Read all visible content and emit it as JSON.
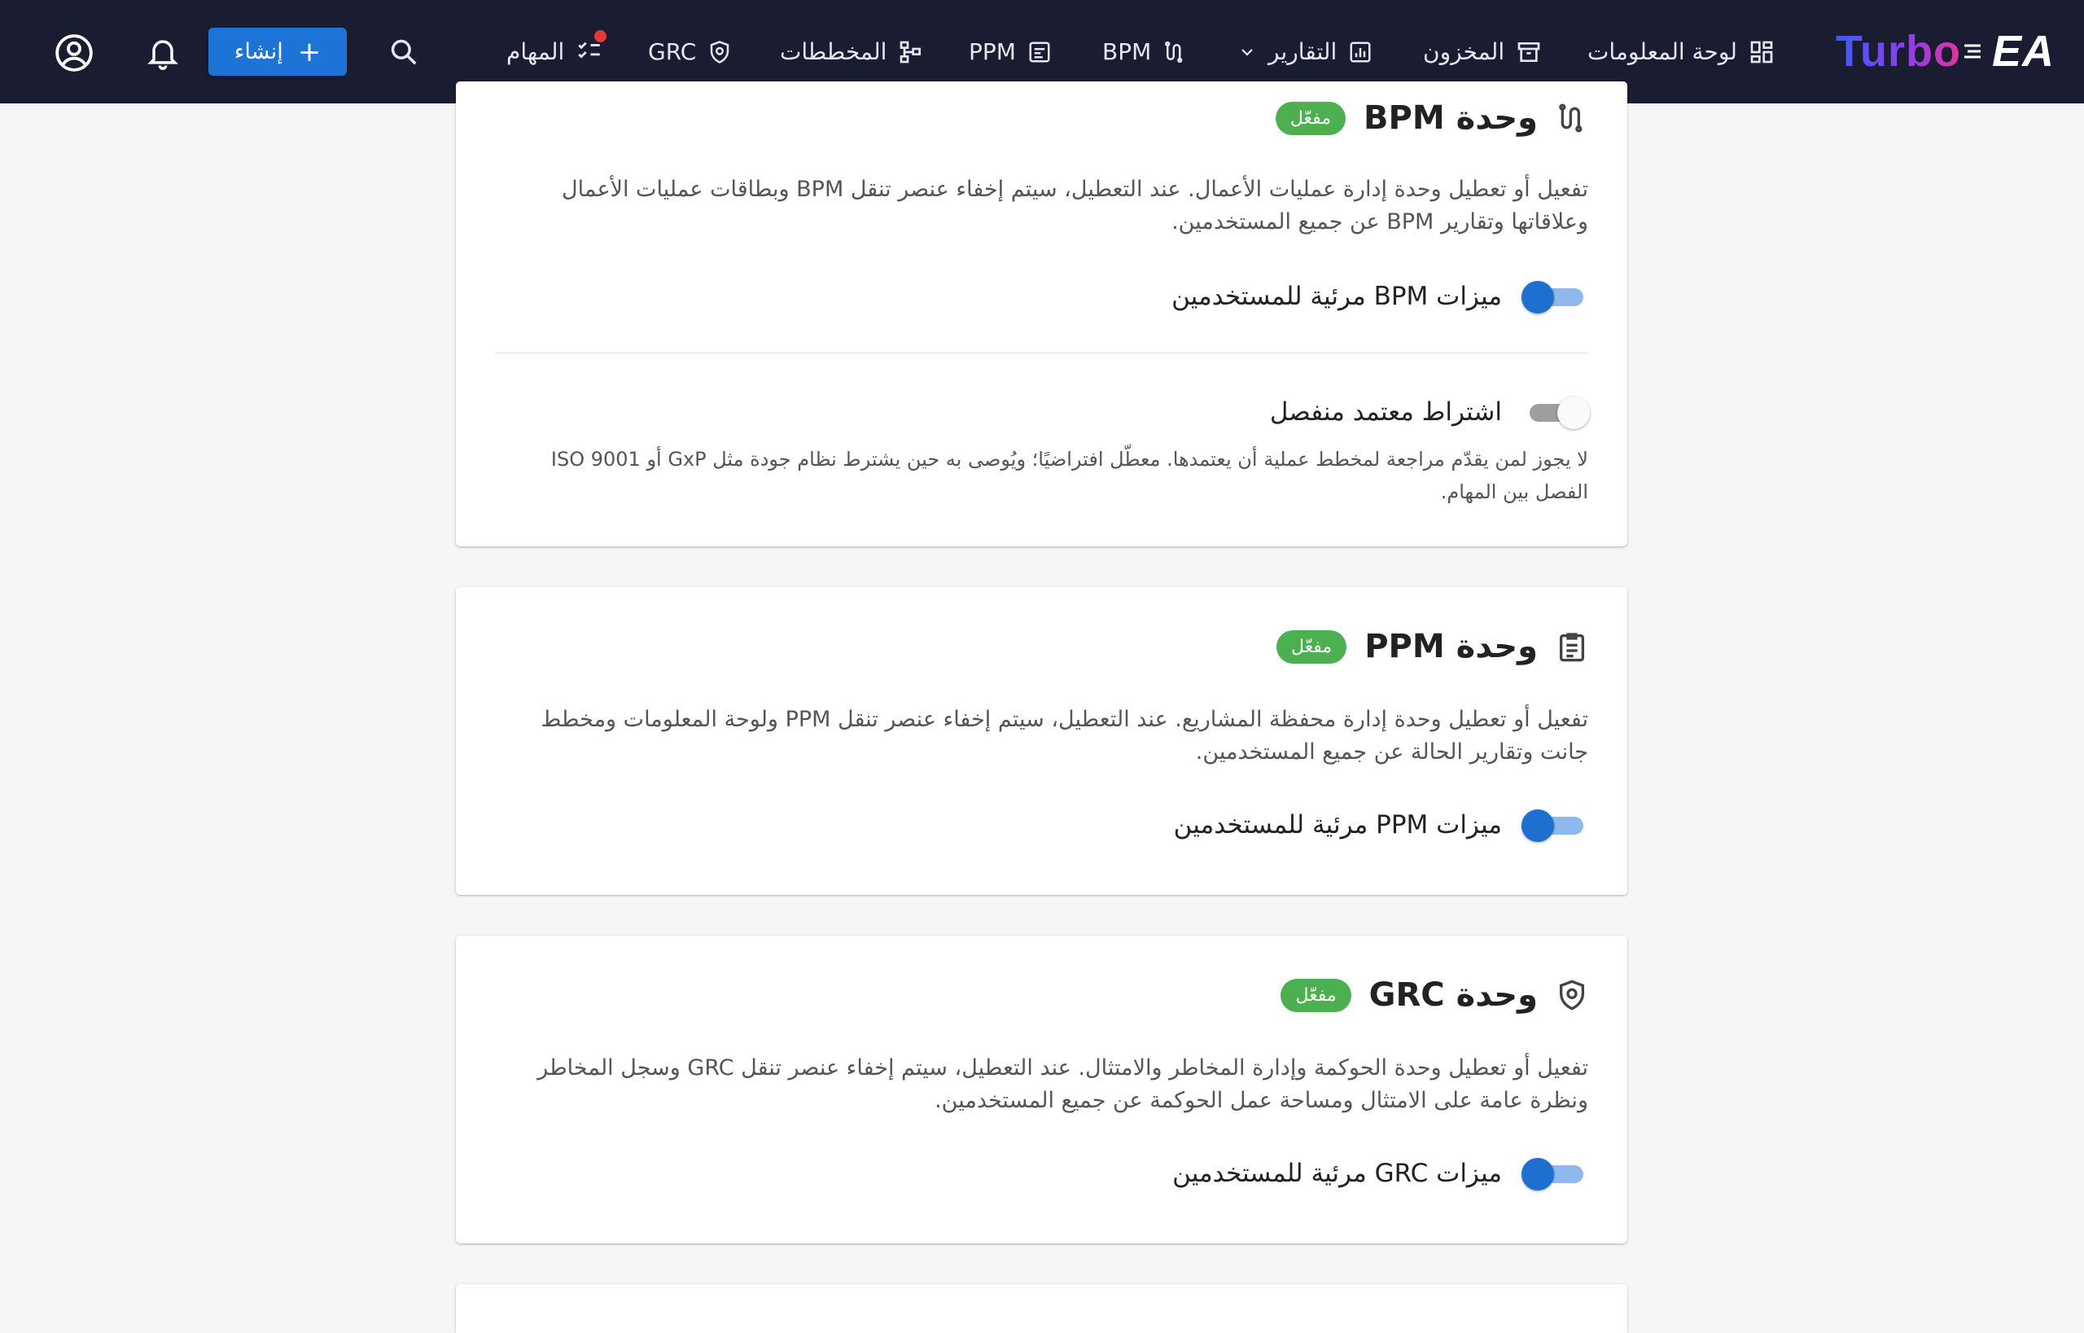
{
  "topbar": {
    "logo_text": "Turbo",
    "logo_suffix": "EA",
    "create_label": "إنشاء",
    "nav": [
      {
        "label": "لوحة المعلومات",
        "icon": "dashboard-icon"
      },
      {
        "label": "المخزون",
        "icon": "inventory-icon"
      },
      {
        "label": "التقارير",
        "icon": "reports-icon"
      },
      {
        "label": "BPM",
        "icon": "bpm-icon"
      },
      {
        "label": "PPM",
        "icon": "ppm-icon"
      },
      {
        "label": "المخططات",
        "icon": "diagrams-icon"
      },
      {
        "label": "GRC",
        "icon": "grc-icon"
      },
      {
        "label": "المهام",
        "icon": "tasks-icon"
      }
    ]
  },
  "cards": [
    {
      "title": "وحدة BPM",
      "badge": "مفعّل",
      "description": "تفعيل أو تعطيل وحدة إدارة عمليات الأعمال. عند التعطيل، سيتم إخفاء عنصر تنقل BPM وبطاقات عمليات الأعمال وعلاقاتها وتقارير BPM عن جميع المستخدمين.",
      "toggle_label": "ميزات BPM مرئية للمستخدمين",
      "toggle_on": true,
      "extra_toggle_label": "اشتراط معتمد منفصل",
      "extra_toggle_on": false,
      "extra_description": "لا يجوز لمن يقدّم مراجعة لمخطط عملية أن يعتمدها. معطّل افتراضيًا؛ ويُوصى به حين يشترط نظام جودة مثل GxP أو ISO 9001 الفصل بين المهام."
    },
    {
      "title": "وحدة PPM",
      "badge": "مفعّل",
      "description": "تفعيل أو تعطيل وحدة إدارة محفظة المشاريع. عند التعطيل، سيتم إخفاء عنصر تنقل PPM ولوحة المعلومات ومخطط جانت وتقارير الحالة عن جميع المستخدمين.",
      "toggle_label": "ميزات PPM مرئية للمستخدمين",
      "toggle_on": true
    },
    {
      "title": "وحدة GRC",
      "badge": "مفعّل",
      "description": "تفعيل أو تعطيل وحدة الحوكمة وإدارة المخاطر والامتثال. عند التعطيل، سيتم إخفاء عنصر تنقل GRC وسجل المخاطر ونظرة عامة على الامتثال ومساحة عمل الحوكمة عن جميع المستخدمين.",
      "toggle_label": "ميزات GRC مرئية للمستخدمين",
      "toggle_on": true
    }
  ],
  "colors": {
    "topbar": "#1a1c32",
    "primary": "#1e74d6",
    "badge_green": "#4caf50",
    "notification_dot": "#e53935"
  }
}
